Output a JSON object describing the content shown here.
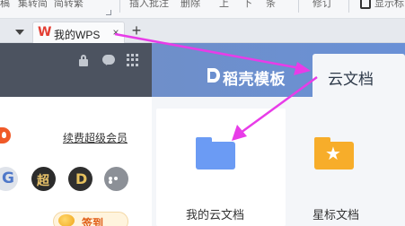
{
  "ribbon": {
    "items": [
      "稿",
      "集转简",
      "简转繁",
      "插入批注",
      "删除",
      "上",
      "下",
      "条",
      "修订",
      "显示标"
    ]
  },
  "tabbar": {
    "active_tab": {
      "title": "我的WPS",
      "close": "×"
    },
    "new_tab": "+"
  },
  "header": {
    "brand_name": "稻壳模板",
    "cloud_tab_label": "云文档"
  },
  "left_panel": {
    "renew_link": "续费超级会员",
    "app_icons": [
      {
        "name": "g-app",
        "glyph": "G"
      },
      {
        "name": "chao-app",
        "glyph": "超"
      },
      {
        "name": "d-app",
        "glyph": "D"
      },
      {
        "name": "more-apps",
        "glyph": "..."
      }
    ],
    "signin_label": "签到"
  },
  "cloud_docs": {
    "cards": [
      {
        "label": "我的云文档",
        "icon": "blue-folder-icon"
      },
      {
        "label": "星标文档",
        "icon": "star-folder-icon"
      }
    ]
  },
  "colors": {
    "header_blue": "#6990d6",
    "dark_panel": "#4c5360",
    "folder_blue": "#6b9bf4",
    "folder_orange": "#f7ad2a",
    "annotation_arrow": "#e83ce8"
  }
}
